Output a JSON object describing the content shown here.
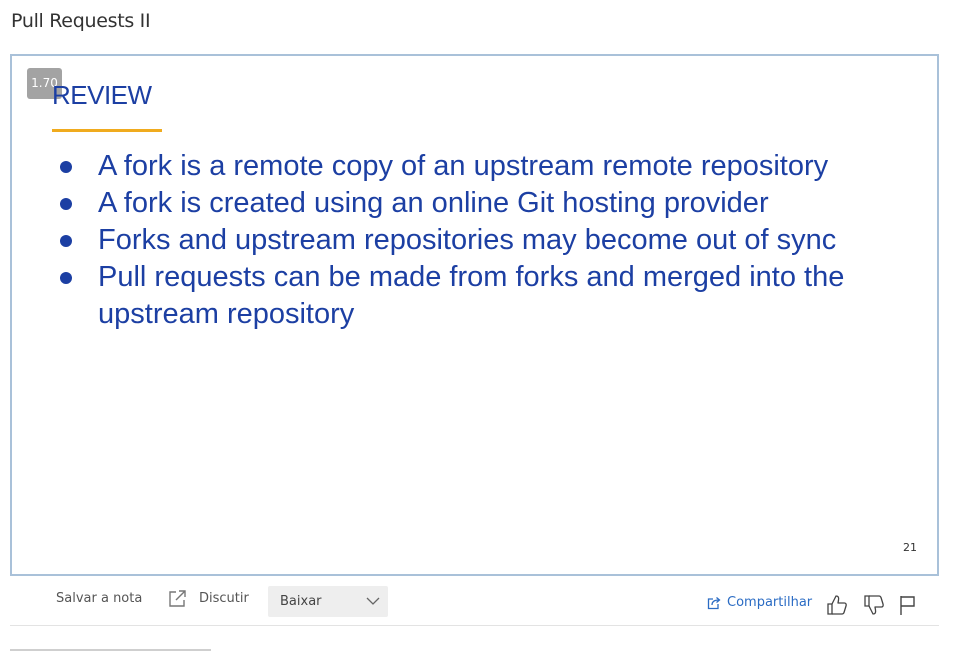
{
  "page": {
    "title": "Pull Requests II"
  },
  "slide": {
    "speed": "1.70",
    "heading": "REVIEW",
    "bullets": [
      "A fork is a remote copy of an upstream remote repository",
      "A fork is created using an online Git hosting provider",
      "Forks and upstream repositories may become out of sync",
      "Pull requests can be made from forks and merged into the upstream repository"
    ],
    "slide_number": "21",
    "colors": {
      "text": "#1c3fa3",
      "underline": "#f0ab1e",
      "frame_border": "#a9c1d9"
    }
  },
  "toolbar": {
    "save_label": "Salvar a nota",
    "discuss_label": "Discutir",
    "download_select": {
      "selected": "Baixar"
    },
    "share_label": "Compartilhar",
    "icons": {
      "discuss": "external-link-icon",
      "share": "share-icon",
      "like": "thumbs-up-icon",
      "dislike": "thumbs-down-icon",
      "flag": "flag-icon",
      "select": "chevron-down-icon"
    },
    "colors": {
      "link": "#2b6cc4"
    }
  }
}
